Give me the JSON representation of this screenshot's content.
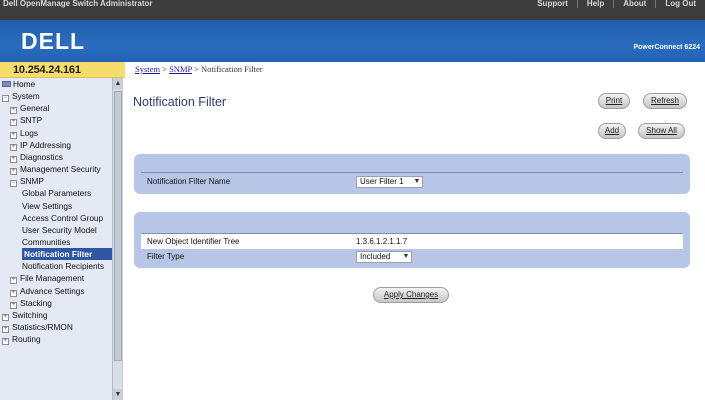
{
  "topbar": {
    "title": "Dell OpenManage Switch Administrator",
    "links": [
      "Support",
      "Help",
      "About",
      "Log Out"
    ]
  },
  "header": {
    "logo_text": "DELL",
    "product": "PowerConnect 6224"
  },
  "ipbar": {
    "ip": "10.254.24.161"
  },
  "breadcrumb": {
    "parts": [
      "System",
      "SNMP",
      "Notification Filter"
    ],
    "sep": " > "
  },
  "sidebar": {
    "items": [
      {
        "label": "Home",
        "level": 0,
        "icon": "folder-icon"
      },
      {
        "label": "System",
        "level": 0,
        "toggle": "−"
      },
      {
        "label": "General",
        "level": 1,
        "toggle": "+"
      },
      {
        "label": "SNTP",
        "level": 1,
        "toggle": "+"
      },
      {
        "label": "Logs",
        "level": 1,
        "toggle": "+"
      },
      {
        "label": "IP Addressing",
        "level": 1,
        "toggle": "+"
      },
      {
        "label": "Diagnostics",
        "level": 1,
        "toggle": "+"
      },
      {
        "label": "Management Security",
        "level": 1,
        "toggle": "+"
      },
      {
        "label": "SNMP",
        "level": 1,
        "toggle": "−"
      },
      {
        "label": "Global Parameters",
        "level": 2
      },
      {
        "label": "View Settings",
        "level": 2
      },
      {
        "label": "Access Control Group",
        "level": 2
      },
      {
        "label": "User Security Model",
        "level": 2
      },
      {
        "label": "Communities",
        "level": 2
      },
      {
        "label": "Notification Filter",
        "level": 2,
        "selected": true
      },
      {
        "label": "Notification Recipients",
        "level": 2
      },
      {
        "label": "File Management",
        "level": 1,
        "toggle": "+"
      },
      {
        "label": "Advance Settings",
        "level": 1,
        "toggle": "+"
      },
      {
        "label": "Stacking",
        "level": 1,
        "toggle": "+"
      },
      {
        "label": "Switching",
        "level": 0,
        "toggle": "+"
      },
      {
        "label": "Statistics/RMON",
        "level": 0,
        "toggle": "+"
      },
      {
        "label": "Routing",
        "level": 0,
        "toggle": "+"
      }
    ]
  },
  "main": {
    "title": "Notification Filter",
    "buttons": {
      "print": "Print",
      "refresh": "Refresh",
      "add": "Add",
      "show_all": "Show All",
      "apply": "Apply Changes"
    },
    "filter_name_label": "Notification Filter Name",
    "filter_name_value": "User Filter 1",
    "oid_label": "New Object Identifier Tree",
    "oid_value": "1.3.6.1.2.1.1.7",
    "filter_type_label": "Filter Type",
    "filter_type_value": "Included"
  },
  "colors": {
    "topbar": "#3d3d3d",
    "header": "#2a6cc0",
    "ipbar": "#f6dd6b",
    "panel": "#b7c5e6",
    "title": "#2b3b73",
    "sidebar_selected": "#2d56a4"
  }
}
